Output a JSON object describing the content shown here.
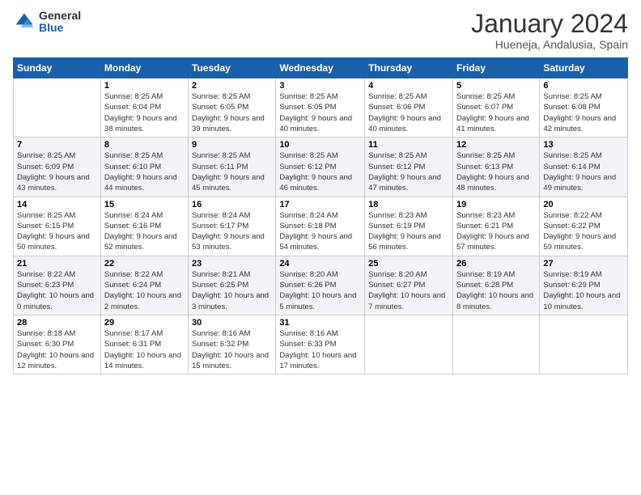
{
  "header": {
    "logo_general": "General",
    "logo_blue": "Blue",
    "title": "January 2024",
    "subtitle": "Hueneja, Andalusia, Spain"
  },
  "days_of_week": [
    "Sunday",
    "Monday",
    "Tuesday",
    "Wednesday",
    "Thursday",
    "Friday",
    "Saturday"
  ],
  "weeks": [
    [
      {
        "day": "",
        "sunrise": "",
        "sunset": "",
        "daylight": ""
      },
      {
        "day": "1",
        "sunrise": "Sunrise: 8:25 AM",
        "sunset": "Sunset: 6:04 PM",
        "daylight": "Daylight: 9 hours and 38 minutes."
      },
      {
        "day": "2",
        "sunrise": "Sunrise: 8:25 AM",
        "sunset": "Sunset: 6:05 PM",
        "daylight": "Daylight: 9 hours and 39 minutes."
      },
      {
        "day": "3",
        "sunrise": "Sunrise: 8:25 AM",
        "sunset": "Sunset: 6:05 PM",
        "daylight": "Daylight: 9 hours and 40 minutes."
      },
      {
        "day": "4",
        "sunrise": "Sunrise: 8:25 AM",
        "sunset": "Sunset: 6:06 PM",
        "daylight": "Daylight: 9 hours and 40 minutes."
      },
      {
        "day": "5",
        "sunrise": "Sunrise: 8:25 AM",
        "sunset": "Sunset: 6:07 PM",
        "daylight": "Daylight: 9 hours and 41 minutes."
      },
      {
        "day": "6",
        "sunrise": "Sunrise: 8:25 AM",
        "sunset": "Sunset: 6:08 PM",
        "daylight": "Daylight: 9 hours and 42 minutes."
      }
    ],
    [
      {
        "day": "7",
        "sunrise": "Sunrise: 8:25 AM",
        "sunset": "Sunset: 6:09 PM",
        "daylight": "Daylight: 9 hours and 43 minutes."
      },
      {
        "day": "8",
        "sunrise": "Sunrise: 8:25 AM",
        "sunset": "Sunset: 6:10 PM",
        "daylight": "Daylight: 9 hours and 44 minutes."
      },
      {
        "day": "9",
        "sunrise": "Sunrise: 8:25 AM",
        "sunset": "Sunset: 6:11 PM",
        "daylight": "Daylight: 9 hours and 45 minutes."
      },
      {
        "day": "10",
        "sunrise": "Sunrise: 8:25 AM",
        "sunset": "Sunset: 6:12 PM",
        "daylight": "Daylight: 9 hours and 46 minutes."
      },
      {
        "day": "11",
        "sunrise": "Sunrise: 8:25 AM",
        "sunset": "Sunset: 6:12 PM",
        "daylight": "Daylight: 9 hours and 47 minutes."
      },
      {
        "day": "12",
        "sunrise": "Sunrise: 8:25 AM",
        "sunset": "Sunset: 6:13 PM",
        "daylight": "Daylight: 9 hours and 48 minutes."
      },
      {
        "day": "13",
        "sunrise": "Sunrise: 8:25 AM",
        "sunset": "Sunset: 6:14 PM",
        "daylight": "Daylight: 9 hours and 49 minutes."
      }
    ],
    [
      {
        "day": "14",
        "sunrise": "Sunrise: 8:25 AM",
        "sunset": "Sunset: 6:15 PM",
        "daylight": "Daylight: 9 hours and 50 minutes."
      },
      {
        "day": "15",
        "sunrise": "Sunrise: 8:24 AM",
        "sunset": "Sunset: 6:16 PM",
        "daylight": "Daylight: 9 hours and 52 minutes."
      },
      {
        "day": "16",
        "sunrise": "Sunrise: 8:24 AM",
        "sunset": "Sunset: 6:17 PM",
        "daylight": "Daylight: 9 hours and 53 minutes."
      },
      {
        "day": "17",
        "sunrise": "Sunrise: 8:24 AM",
        "sunset": "Sunset: 6:18 PM",
        "daylight": "Daylight: 9 hours and 54 minutes."
      },
      {
        "day": "18",
        "sunrise": "Sunrise: 8:23 AM",
        "sunset": "Sunset: 6:19 PM",
        "daylight": "Daylight: 9 hours and 56 minutes."
      },
      {
        "day": "19",
        "sunrise": "Sunrise: 8:23 AM",
        "sunset": "Sunset: 6:21 PM",
        "daylight": "Daylight: 9 hours and 57 minutes."
      },
      {
        "day": "20",
        "sunrise": "Sunrise: 8:22 AM",
        "sunset": "Sunset: 6:22 PM",
        "daylight": "Daylight: 9 hours and 59 minutes."
      }
    ],
    [
      {
        "day": "21",
        "sunrise": "Sunrise: 8:22 AM",
        "sunset": "Sunset: 6:23 PM",
        "daylight": "Daylight: 10 hours and 0 minutes."
      },
      {
        "day": "22",
        "sunrise": "Sunrise: 8:22 AM",
        "sunset": "Sunset: 6:24 PM",
        "daylight": "Daylight: 10 hours and 2 minutes."
      },
      {
        "day": "23",
        "sunrise": "Sunrise: 8:21 AM",
        "sunset": "Sunset: 6:25 PM",
        "daylight": "Daylight: 10 hours and 3 minutes."
      },
      {
        "day": "24",
        "sunrise": "Sunrise: 8:20 AM",
        "sunset": "Sunset: 6:26 PM",
        "daylight": "Daylight: 10 hours and 5 minutes."
      },
      {
        "day": "25",
        "sunrise": "Sunrise: 8:20 AM",
        "sunset": "Sunset: 6:27 PM",
        "daylight": "Daylight: 10 hours and 7 minutes."
      },
      {
        "day": "26",
        "sunrise": "Sunrise: 8:19 AM",
        "sunset": "Sunset: 6:28 PM",
        "daylight": "Daylight: 10 hours and 8 minutes."
      },
      {
        "day": "27",
        "sunrise": "Sunrise: 8:19 AM",
        "sunset": "Sunset: 6:29 PM",
        "daylight": "Daylight: 10 hours and 10 minutes."
      }
    ],
    [
      {
        "day": "28",
        "sunrise": "Sunrise: 8:18 AM",
        "sunset": "Sunset: 6:30 PM",
        "daylight": "Daylight: 10 hours and 12 minutes."
      },
      {
        "day": "29",
        "sunrise": "Sunrise: 8:17 AM",
        "sunset": "Sunset: 6:31 PM",
        "daylight": "Daylight: 10 hours and 14 minutes."
      },
      {
        "day": "30",
        "sunrise": "Sunrise: 8:16 AM",
        "sunset": "Sunset: 6:32 PM",
        "daylight": "Daylight: 10 hours and 15 minutes."
      },
      {
        "day": "31",
        "sunrise": "Sunrise: 8:16 AM",
        "sunset": "Sunset: 6:33 PM",
        "daylight": "Daylight: 10 hours and 17 minutes."
      },
      {
        "day": "",
        "sunrise": "",
        "sunset": "",
        "daylight": ""
      },
      {
        "day": "",
        "sunrise": "",
        "sunset": "",
        "daylight": ""
      },
      {
        "day": "",
        "sunrise": "",
        "sunset": "",
        "daylight": ""
      }
    ]
  ]
}
